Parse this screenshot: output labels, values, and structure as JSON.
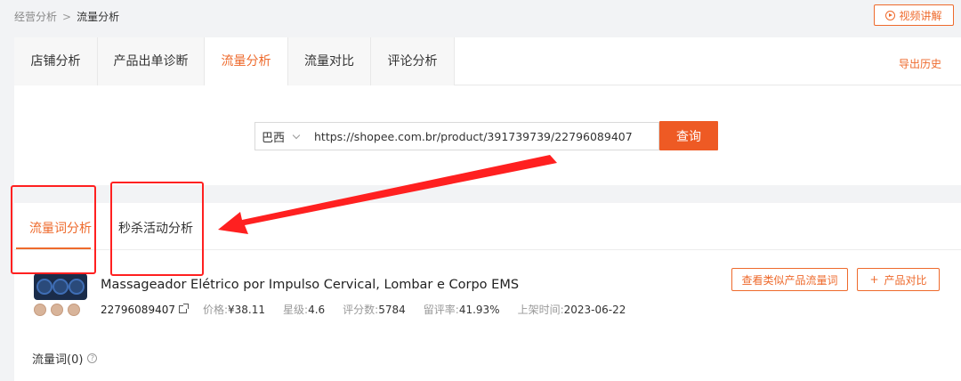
{
  "breadcrumb": {
    "parent": "经营分析",
    "separator": ">",
    "current": "流量分析"
  },
  "header": {
    "video_button": "视频讲解",
    "export_link": "导出历史"
  },
  "tabs": [
    {
      "label": "店铺分析",
      "active": false
    },
    {
      "label": "产品出单诊断",
      "active": false
    },
    {
      "label": "流量分析",
      "active": true
    },
    {
      "label": "流量对比",
      "active": false
    },
    {
      "label": "评论分析",
      "active": false
    }
  ],
  "search": {
    "country": "巴西",
    "url": "https://shopee.com.br/product/391739739/22796089407",
    "button": "查询"
  },
  "subtabs": [
    {
      "label": "流量词分析",
      "active": true
    },
    {
      "label": "秒杀活动分析",
      "active": false
    }
  ],
  "product": {
    "title": "Massageador Elétrico por Impulso Cervical, Lombar e Corpo EMS",
    "id": "22796089407",
    "price_label": "价格:",
    "price": "¥38.11",
    "rating_label": "星级:",
    "rating": "4.6",
    "reviews_label": "评分数:",
    "reviews": "5784",
    "retention_label": "留评率:",
    "retention": "41.93%",
    "listed_label": "上架时间:",
    "listed": "2023-06-22"
  },
  "actions": {
    "similar": "查看类似产品流量词",
    "compare_plus": "+",
    "compare": "产品对比"
  },
  "keywords": {
    "title": "流量词(0)",
    "help_icon": "?"
  },
  "colors": {
    "accent": "#ee6a2c",
    "annotation": "#ff2020"
  }
}
